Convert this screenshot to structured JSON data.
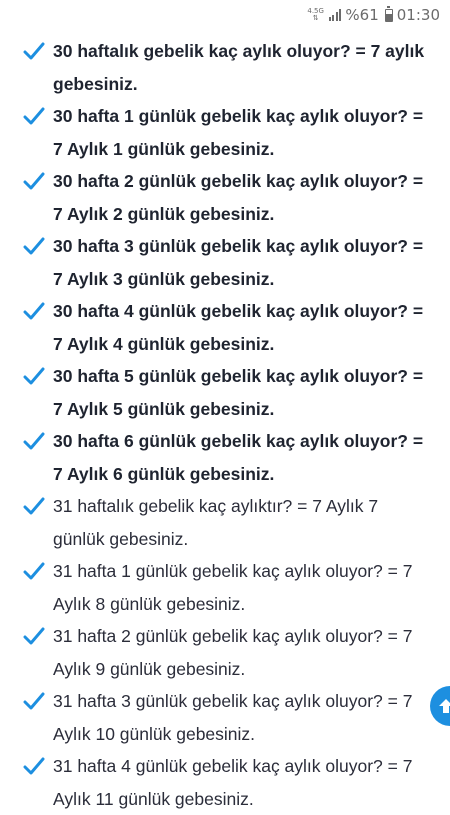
{
  "status_bar": {
    "network_top": "4.5G",
    "network_bottom": "⇅",
    "battery_text": "%61",
    "battery_level": 0.61,
    "time": "01:30"
  },
  "colors": {
    "check": "#1d8fe0",
    "text": "#2b2d3a",
    "scroll_button": "#1d8fe0"
  },
  "items": [
    {
      "text": "30 haftalık gebelik kaç aylık oluyor? = 7 aylık gebesiniz.",
      "bold": true
    },
    {
      "text": "30 hafta 1 günlük gebelik kaç aylık oluyor? = 7 Aylık 1 günlük gebesiniz.",
      "bold": true
    },
    {
      "text": "30 hafta 2 günlük gebelik kaç aylık oluyor? = 7 Aylık 2 günlük gebesiniz.",
      "bold": true
    },
    {
      "text": "30 hafta 3 günlük gebelik kaç aylık oluyor? = 7 Aylık 3 günlük gebesiniz.",
      "bold": true
    },
    {
      "text": "30 hafta 4 günlük gebelik kaç aylık oluyor? = 7 Aylık 4 günlük gebesiniz.",
      "bold": true
    },
    {
      "text": "30 hafta 5 günlük gebelik kaç aylık oluyor? = 7 Aylık 5 günlük gebesiniz.",
      "bold": true
    },
    {
      "text": "30 hafta 6 günlük gebelik kaç aylık oluyor? = 7 Aylık 6 günlük gebesiniz.",
      "bold": true
    },
    {
      "text": "31 haftalık gebelik kaç aylıktır? = 7 Aylık 7 günlük gebesiniz.",
      "bold": false
    },
    {
      "text": "31 hafta 1 günlük gebelik kaç aylık oluyor? = 7 Aylık 8 günlük gebesiniz.",
      "bold": false
    },
    {
      "text": "31 hafta 2 günlük gebelik kaç aylık oluyor? = 7 Aylık 9 günlük gebesiniz.",
      "bold": false
    },
    {
      "text": "31 hafta 3 günlük gebelik kaç aylık oluyor? = 7 Aylık 10 günlük gebesiniz.",
      "bold": false
    },
    {
      "text": "31 hafta 4 günlük gebelik kaç aylık oluyor? = 7 Aylık 11 günlük gebesiniz.",
      "bold": false
    }
  ],
  "scroll_to_top_icon": "arrow-up-icon"
}
